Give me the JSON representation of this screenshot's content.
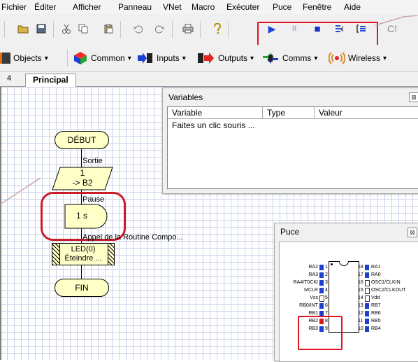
{
  "menu": [
    "Fichier",
    "Éditer",
    "Afficher",
    "Panneau",
    "VNet",
    "Macro",
    "Exécuter",
    "Puce",
    "Fenêtre",
    "Aide"
  ],
  "toolbar": {
    "icons": [
      "open-folder-icon",
      "save-icon",
      "cut-icon",
      "copy-icon",
      "paste-icon",
      "undo-icon",
      "redo-icon",
      "print-icon",
      "help-icon",
      "run-icon",
      "pause-icon",
      "stop-icon",
      "step-into-icon",
      "step-over-icon"
    ],
    "pause_glyph": "II",
    "run_glyph": "▶",
    "stop_glyph": "■",
    "trailing_text": "C!"
  },
  "component_toolbar": {
    "objects": "Objects",
    "common": "Common",
    "inputs": "Inputs",
    "outputs": "Outputs",
    "comms": "Comms",
    "wireless": "Wireless",
    "dropdown_glyph": "▾"
  },
  "tab": {
    "arrow": "4",
    "label": "Principal"
  },
  "flowchart": {
    "start": "DÉBUT",
    "output_label": "Sortie",
    "output_line1": "1",
    "output_line2": "-> B2",
    "pause_label": "Pause",
    "pause_value": "1 s",
    "macro_label": "Appel de la Routine Compo...",
    "macro_line1": "LED(0)",
    "macro_line2": "Éteindre ...",
    "end": "FIN"
  },
  "variables_window": {
    "title": "Variables",
    "close_glyph": "⊠",
    "columns": [
      "Variable",
      "Type",
      "Valeur"
    ],
    "hint": "Faites un clic souris ..."
  },
  "chip_window": {
    "title": "Puce",
    "close_glyph": "⊠",
    "left_pins": [
      {
        "name": "RA2",
        "num": "1"
      },
      {
        "name": "RA3",
        "num": "2"
      },
      {
        "name": "RA4/T0CKI",
        "num": "3"
      },
      {
        "name": "MCLR",
        "num": "4"
      },
      {
        "name": "Vss",
        "num": "5"
      },
      {
        "name": "RB0/INT",
        "num": "6"
      },
      {
        "name": "RB1",
        "num": "7"
      },
      {
        "name": "RB2",
        "num": "8"
      },
      {
        "name": "RB3",
        "num": "9"
      }
    ],
    "right_pins": [
      {
        "name": "RA1",
        "num": "18"
      },
      {
        "name": "RA0",
        "num": "17"
      },
      {
        "name": "OSC1/CLKIN",
        "num": "16"
      },
      {
        "name": "OSC2/CLKOUT",
        "num": "15"
      },
      {
        "name": "Vdd",
        "num": "14"
      },
      {
        "name": "RB7",
        "num": "13"
      },
      {
        "name": "RB6",
        "num": "12"
      },
      {
        "name": "RB5",
        "num": "11"
      },
      {
        "name": "RB4",
        "num": "10"
      }
    ]
  },
  "colors": {
    "highlight": "#e0141e",
    "pin_active": "#1f3fd0",
    "pin_lit": "#d81919",
    "flow_fill": "#ffffc8"
  }
}
